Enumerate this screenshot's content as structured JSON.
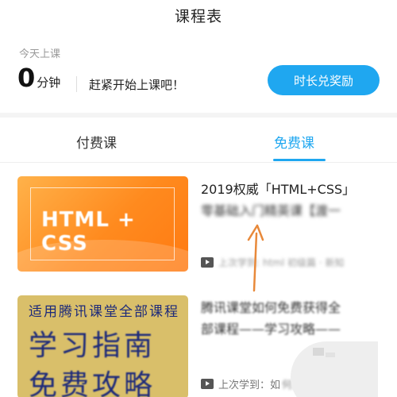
{
  "header": {
    "title": "课程表"
  },
  "summary": {
    "today_label": "今天上课",
    "minutes_value": "0",
    "minutes_unit": "分钟",
    "hint": "赶紧开始上课吧！",
    "reward_button": "时长兑奖励"
  },
  "tabs": [
    {
      "label": "付费课",
      "active": false
    },
    {
      "label": "免费课",
      "active": true
    }
  ],
  "courses": [
    {
      "thumb_text": "HTML + CSS",
      "title_line1": "2019权威「HTML+CSS」",
      "title_line2": "零基础入门精英课【渡一",
      "meta": "上次学到: html 初级篇 · 新知"
    },
    {
      "thumb_line1": "适用腾讯课堂全部课程",
      "thumb_line2": "学习指南",
      "thumb_line3": "免费攻略",
      "title_line1": "腾讯课堂如何免费获得全",
      "title_line2": "部课程——学习攻略——",
      "meta_clear": "上次学到：如",
      "meta_blur": "何免费获得"
    }
  ],
  "colors": {
    "accent": "#1fa7f0",
    "annotation_arrow": "#e8893a"
  }
}
